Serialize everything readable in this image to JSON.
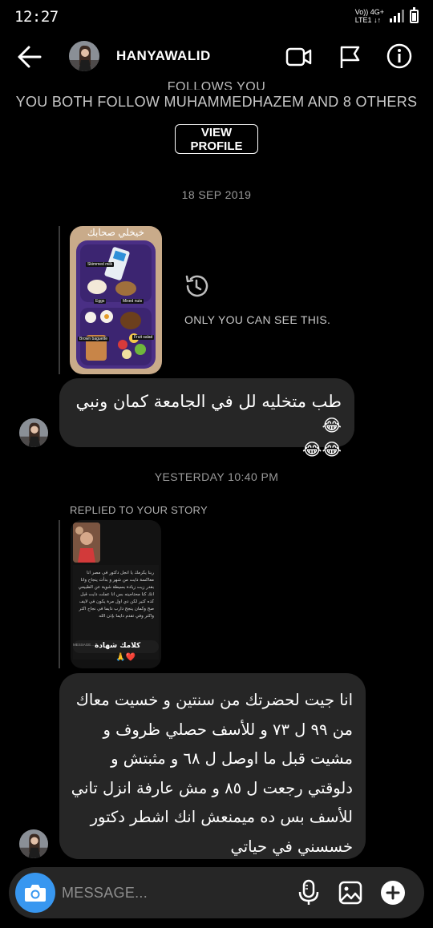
{
  "status_bar": {
    "time": "12:27",
    "network_top": "Vo)) 4G+",
    "network_bottom": "LTE1 ↓↑"
  },
  "header": {
    "username": "HANYAWALID"
  },
  "profile": {
    "follows_you": "FOLLOWS YOU",
    "mutual_followers": "YOU BOTH FOLLOW MUHAMMEDHAZEM AND 8 OTHERS",
    "view_profile_label": "VIEW PROFILE"
  },
  "thread": {
    "date_1": "18 SEP 2019",
    "photo": {
      "title": "خيخلي صحابك",
      "labels": [
        "Skimmed milk",
        "Eggs",
        "Mixed nuts",
        "Brown baguette",
        "Fruit salad"
      ],
      "notice": "ONLY YOU CAN SEE THIS."
    },
    "message_1": "طب متخليه لل في الجامعة كمان ونبي😂",
    "message_1_emoji": "😂😂",
    "date_2": "YESTERDAY 10:40 PM",
    "replied_label": "REPLIED TO YOUR STORY",
    "story": {
      "text": "ربنا يكرمك يا انجل دكتور في مصر انا معاكسة دايت من شهر و بدأت ينجاح وانا بقدر زيت زيادة بسيطة شوية عن الطبيعي انك كنا محتاجينه بس انا عملت دايت قبل كده كتير لكن دي اول مرة يكون في لايف صح وكمان ينجح دارب دايما في نجاح اكتر واكتر وفي تقدم دايما بإذن الله",
      "inner_message_placeholder": "MESSAGE...",
      "caption": "كلامك شهادة",
      "reaction": "🙏❤️"
    },
    "message_2": "انا جيت لحضرتك من سنتين و خسيت معاك من ٩٩ ل ٧٣ و للأسف حصلي ظروف و مشيت قبل ما اوصل ل ٦٨ و مثبتش و دلوقتي رجعت ل ٨٥ و مش عارفة انزل تاني للأسف بس ده ميمنعش انك اشطر دكتور خسسني في حياتي"
  },
  "composer": {
    "placeholder": "MESSAGE..."
  },
  "colors": {
    "background": "#000000",
    "bubble": "#262626",
    "accent": "#3897f0"
  }
}
